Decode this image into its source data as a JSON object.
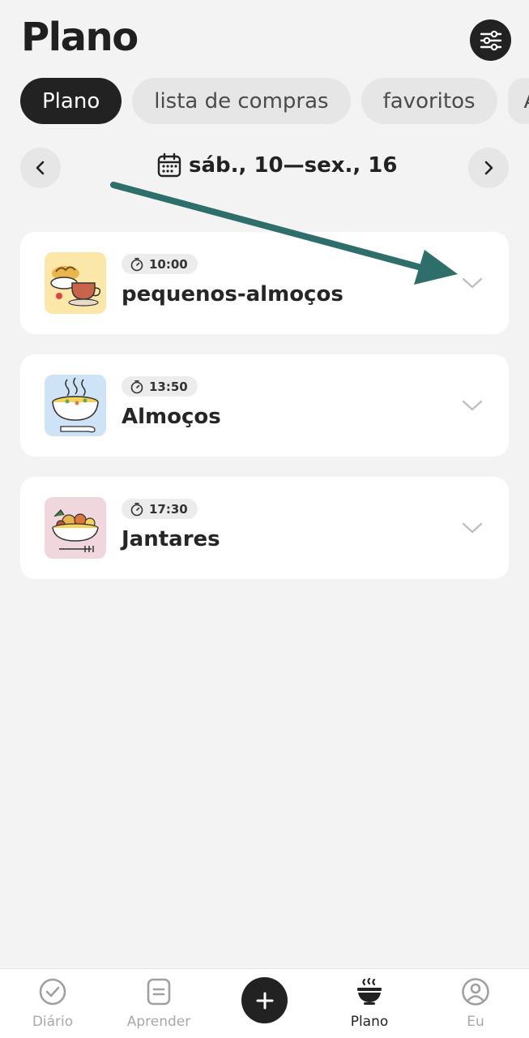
{
  "header": {
    "title": "Plano"
  },
  "tabs": [
    {
      "label": "Plano",
      "active": true
    },
    {
      "label": "lista de compras",
      "active": false
    },
    {
      "label": "favoritos",
      "active": false
    },
    {
      "label": "A",
      "active": false
    }
  ],
  "week": {
    "range": "sáb., 10—sex., 16"
  },
  "meals": [
    {
      "time": "10:00",
      "name": "pequenos-almoços",
      "thumb_color": "#fbe7a7"
    },
    {
      "time": "13:50",
      "name": "Almoços",
      "thumb_color": "#cfe3f6"
    },
    {
      "time": "17:30",
      "name": "Jantares",
      "thumb_color": "#f0d7dd"
    }
  ],
  "annotation": {
    "arrow_color": "#2e6f6b"
  },
  "bottom_nav": [
    {
      "label": "Diário",
      "icon": "check-circle-icon"
    },
    {
      "label": "Aprender",
      "icon": "document-icon"
    },
    {
      "label": "Plano",
      "icon": "bowl-icon",
      "active": true
    },
    {
      "label": "Eu",
      "icon": "person-circle-icon"
    }
  ],
  "icons": {
    "settings": "sliders-icon",
    "prev": "chevron-left-icon",
    "next": "chevron-right-icon",
    "calendar": "calendar-icon",
    "timer": "stopwatch-icon",
    "expand": "chevron-down-icon",
    "add": "plus-icon"
  }
}
